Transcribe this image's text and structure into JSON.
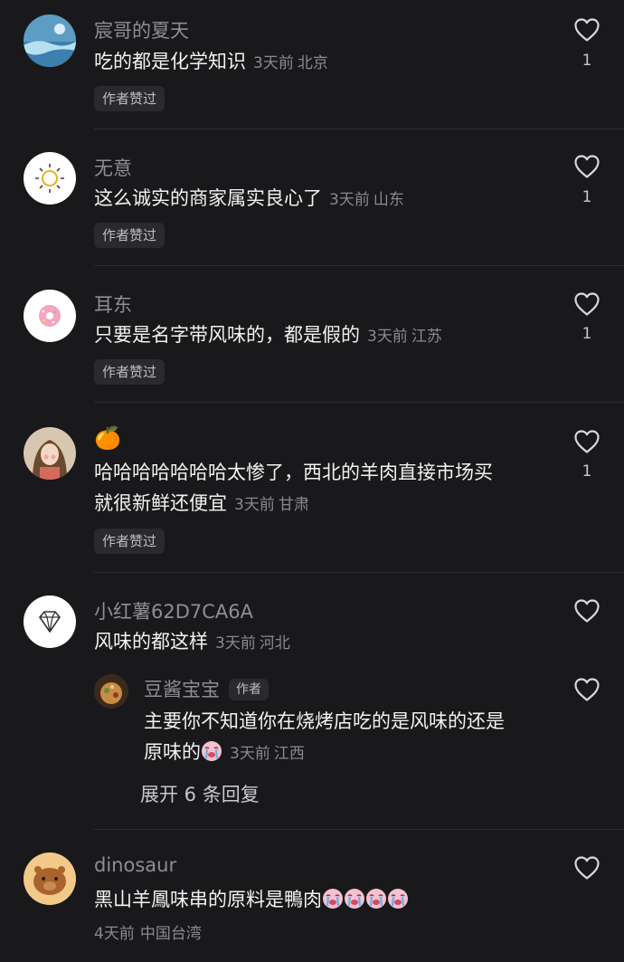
{
  "comments": [
    {
      "username": "宸哥的夏天",
      "text": "吃的都是化学知识",
      "time": "3天前",
      "location": "北京",
      "badge": "作者赞过",
      "likes": "1"
    },
    {
      "username": "无意",
      "text": "这么诚实的商家属实良心了",
      "time": "3天前",
      "location": "山东",
      "badge": "作者赞过",
      "likes": "1"
    },
    {
      "username": "耳东",
      "text": "只要是名字带风味的，都是假的",
      "time": "3天前",
      "location": "江苏",
      "badge": "作者赞过",
      "likes": "1"
    },
    {
      "username_emoji": "🍊",
      "text_line1": "哈哈哈哈哈哈哈太惨了，西北的羊肉直接市场买",
      "text_line2": "就很新鲜还便宜",
      "time": "3天前",
      "location": "甘肃",
      "badge": "作者赞过",
      "likes": "1"
    },
    {
      "username": "小红薯62D7CA6A",
      "text": "风味的都这样",
      "time": "3天前",
      "location": "河北"
    },
    {
      "username": "dinosaur",
      "text": "黑山羊鳳味串的原料是鴨肉",
      "emoji_count": 4,
      "time": "4天前",
      "location": "中国台湾"
    }
  ],
  "reply": {
    "username": "豆酱宝宝",
    "author_tag": "作者",
    "text_line1": "主要你不知道你在烧烤店吃的是风味的还是",
    "text_line2": "原味的",
    "time": "3天前",
    "location": "江西"
  },
  "expand_replies": "展开 6 条回复",
  "icons": {
    "like": "heart-outline-icon",
    "crying": "loudly-crying-emoji",
    "accent_text": "#f2f2f2",
    "meta_color": "#8a8a8e"
  }
}
